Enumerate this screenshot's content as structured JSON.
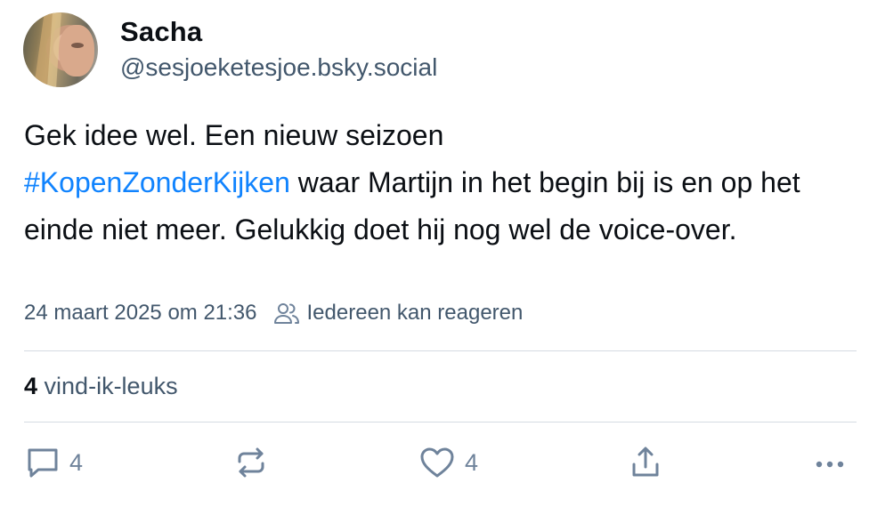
{
  "author": {
    "display_name": "Sacha",
    "handle": "@sesjoeketesjoe.bsky.social"
  },
  "post": {
    "text_before": "Gek idee wel. Een nieuw seizoen",
    "hashtag": "#KopenZonderKijken",
    "text_after": " waar Martijn in het begin bij is en op het einde niet meer. Gelukkig doet hij nog wel de voice-over."
  },
  "meta": {
    "timestamp": "24 maart 2025 om 21:36",
    "reply_setting": "Iedereen kan reageren"
  },
  "likes": {
    "count": "4",
    "label": "vind-ik-leuks"
  },
  "actions": {
    "reply_count": "4",
    "repost_count": "",
    "like_count": "4"
  },
  "colors": {
    "link": "#1083fe",
    "muted": "#42576c",
    "icon": "#6f839b"
  }
}
